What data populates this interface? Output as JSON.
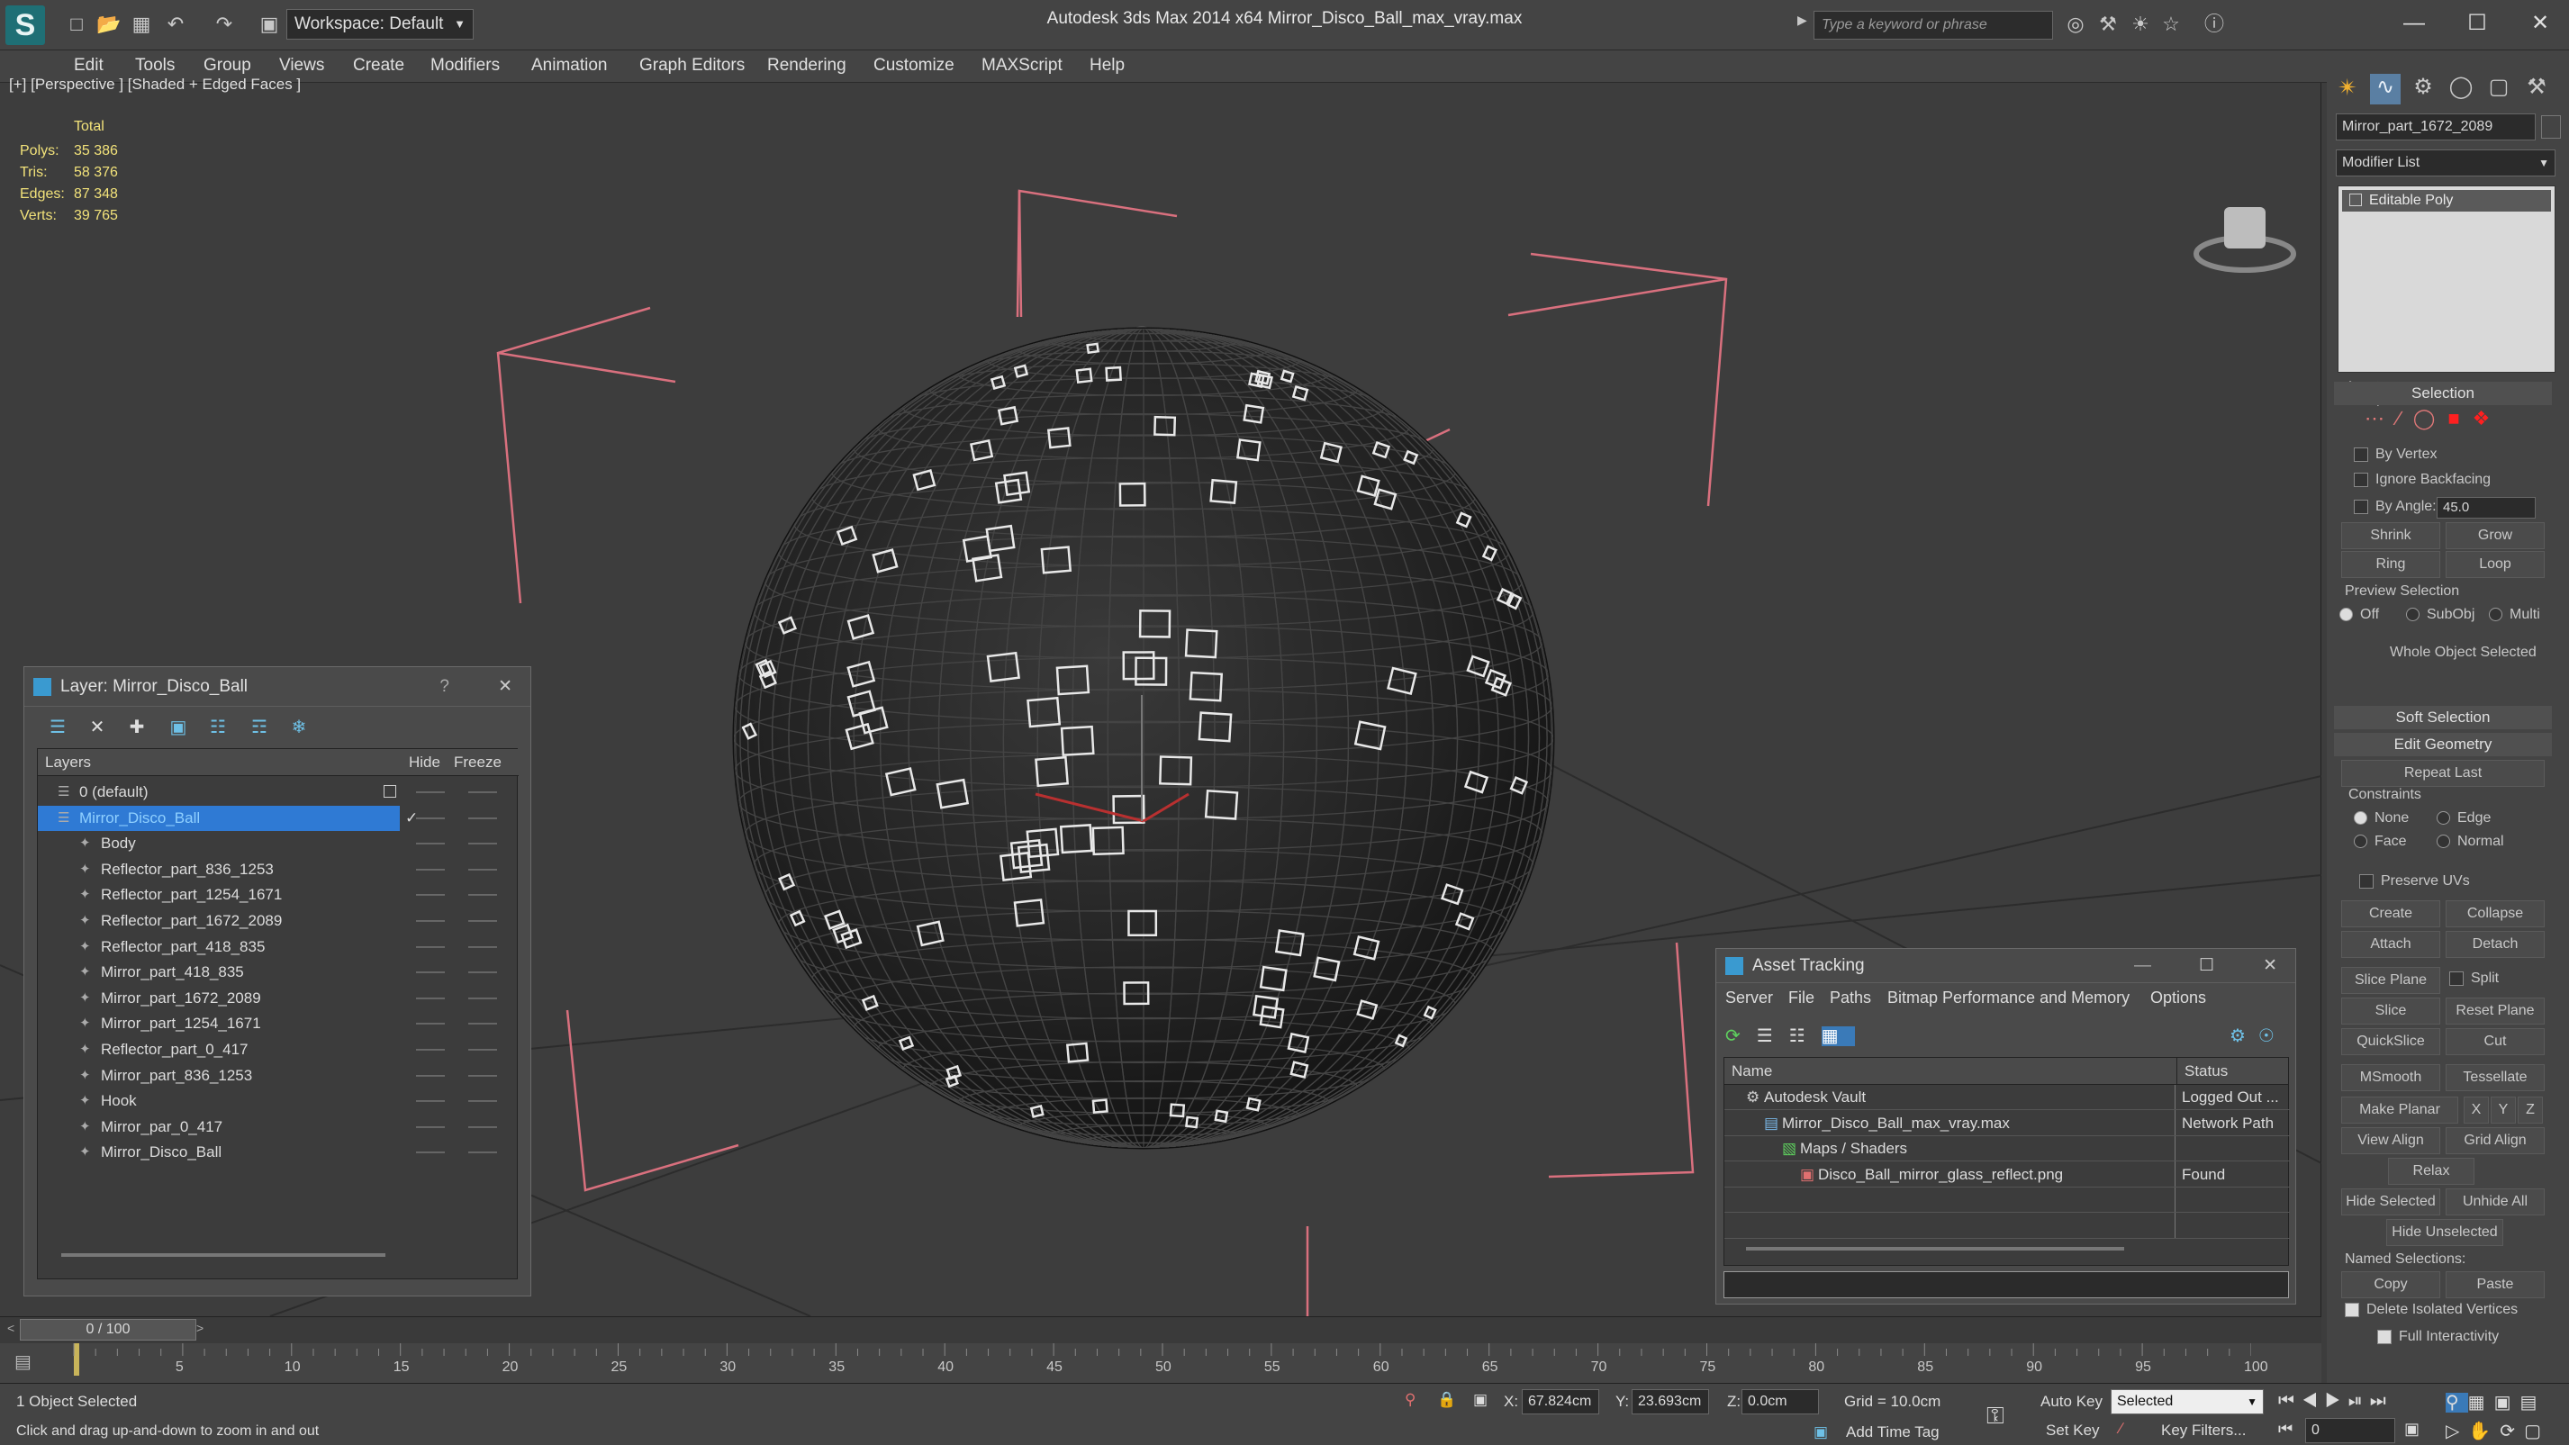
{
  "titlebar": {
    "app_title": "Autodesk 3ds Max  2014 x64      Mirror_Disco_Ball_max_vray.max",
    "workspace": "Workspace: Default",
    "search_placeholder": "Type a keyword or phrase",
    "minimize": "—",
    "maximize": "☐",
    "close": "✕"
  },
  "menubar": [
    "Edit",
    "Tools",
    "Group",
    "Views",
    "Create",
    "Modifiers",
    "Animation",
    "Graph Editors",
    "Rendering",
    "Customize",
    "MAXScript",
    "Help"
  ],
  "viewport": {
    "label": "[+] [Perspective ] [Shaded + Edged Faces ]",
    "stats": {
      "header": "Total",
      "rows": [
        {
          "label": "Polys:",
          "value": "35 386"
        },
        {
          "label": "Tris:",
          "value": "58 376"
        },
        {
          "label": "Edges:",
          "value": "87 348"
        },
        {
          "label": "Verts:",
          "value": "39 765"
        }
      ]
    }
  },
  "command_panel": {
    "object_name": "Mirror_part_1672_2089",
    "modifier_list": "Modifier List",
    "stack_item": "Editable Poly",
    "selection": {
      "title": "Selection",
      "by_vertex": "By Vertex",
      "ignore_backfacing": "Ignore Backfacing",
      "by_angle": "By Angle:",
      "angle_value": "45.0",
      "shrink": "Shrink",
      "grow": "Grow",
      "ring": "Ring",
      "loop": "Loop",
      "preview_selection": "Preview Selection",
      "off": "Off",
      "subobj": "SubObj",
      "multi": "Multi",
      "whole_object": "Whole Object Selected"
    },
    "soft_selection": "Soft Selection",
    "edit_geometry": {
      "title": "Edit Geometry",
      "repeat_last": "Repeat Last",
      "constraints": "Constraints",
      "none": "None",
      "edge": "Edge",
      "face": "Face",
      "normal": "Normal",
      "preserve_uvs": "Preserve UVs",
      "create": "Create",
      "collapse": "Collapse",
      "attach": "Attach",
      "detach": "Detach",
      "slice_plane": "Slice Plane",
      "split": "Split",
      "slice": "Slice",
      "reset_plane": "Reset Plane",
      "quickslice": "QuickSlice",
      "cut": "Cut",
      "msmooth": "MSmooth",
      "tessellate": "Tessellate",
      "make_planar": "Make Planar",
      "x": "X",
      "y": "Y",
      "z": "Z",
      "view_align": "View Align",
      "grid_align": "Grid Align",
      "relax": "Relax",
      "hide_selected": "Hide Selected",
      "unhide_all": "Unhide All",
      "hide_unselected": "Hide Unselected",
      "named_selections": "Named Selections:",
      "copy": "Copy",
      "paste": "Paste",
      "delete_isolated": "Delete Isolated Vertices",
      "full_interactivity": "Full Interactivity"
    }
  },
  "layer_dialog": {
    "title": "Layer: Mirror_Disco_Ball",
    "help": "?",
    "close": "✕",
    "col_layers": "Layers",
    "col_hide": "Hide",
    "col_freeze": "Freeze",
    "rows": [
      "0 (default)",
      "Mirror_Disco_Ball",
      "Body",
      "Reflector_part_836_1253",
      "Reflector_part_1254_1671",
      "Reflector_part_1672_2089",
      "Reflector_part_418_835",
      "Mirror_part_418_835",
      "Mirror_part_1672_2089",
      "Mirror_part_1254_1671",
      "Reflector_part_0_417",
      "Mirror_part_836_1253",
      "Hook",
      "Mirror_par_0_417",
      "Mirror_Disco_Ball"
    ]
  },
  "asset_dialog": {
    "title": "Asset Tracking",
    "menu": [
      "Server",
      "File",
      "Paths",
      "Bitmap Performance and Memory",
      "Options"
    ],
    "col_name": "Name",
    "col_status": "Status",
    "rows": [
      {
        "name": "Autodesk Vault",
        "status": "Logged Out ..."
      },
      {
        "name": "Mirror_Disco_Ball_max_vray.max",
        "status": "Network Path"
      },
      {
        "name": "Maps / Shaders",
        "status": ""
      },
      {
        "name": "Disco_Ball_mirror_glass_reflect.png",
        "status": "Found"
      }
    ]
  },
  "timeline": {
    "frame_counter": "0 / 100",
    "ticks": [
      "5",
      "10",
      "15",
      "20",
      "25",
      "30",
      "35",
      "40",
      "45",
      "50",
      "55",
      "60",
      "65",
      "70",
      "75",
      "80",
      "85",
      "90",
      "95",
      "100"
    ]
  },
  "statusbar": {
    "selection_count": "1 Object Selected",
    "prompt": "Click and drag up-and-down to zoom in and out",
    "x_label": "X:",
    "x_value": "67.824cm",
    "y_label": "Y:",
    "y_value": "23.693cm",
    "z_label": "Z:",
    "z_value": "0.0cm",
    "grid": "Grid = 10.0cm",
    "add_time_tag": "Add Time Tag",
    "auto_key": "Auto Key",
    "key_mode": "Selected",
    "set_key": "Set Key",
    "key_filters": "Key Filters...",
    "current_frame": "0"
  }
}
